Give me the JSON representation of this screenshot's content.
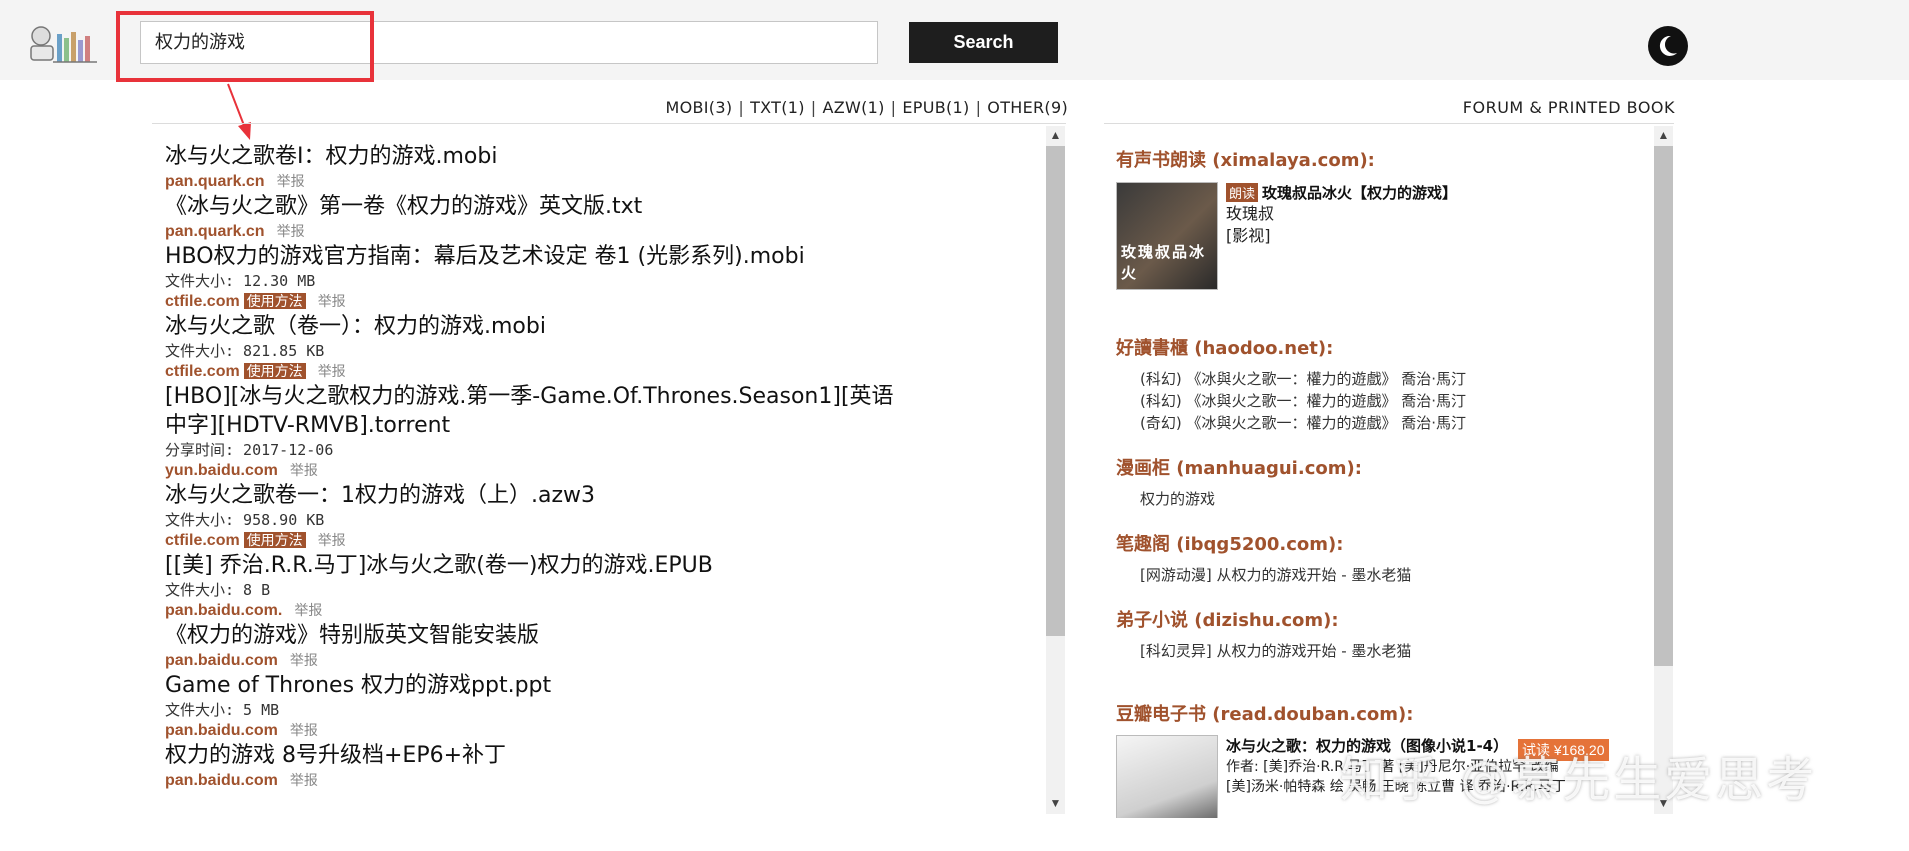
{
  "header": {
    "search": {
      "value": "权力的游戏"
    },
    "search_button_label": "Search"
  },
  "filters": {
    "items": [
      "MOBI(3)",
      "TXT(1)",
      "AZW(1)",
      "EPUB(1)",
      "OTHER(9)"
    ]
  },
  "forum_link": "FORUM & PRINTED BOOK",
  "results": [
    {
      "title": "冰与火之歌卷Ⅰ：权力的游戏.mobi",
      "meta": "",
      "source": "pan.quark.cn",
      "tag": "",
      "report": "举报"
    },
    {
      "title": "《冰与火之歌》第一卷《权力的游戏》英文版.txt",
      "meta": "",
      "source": "pan.quark.cn",
      "tag": "",
      "report": "举报"
    },
    {
      "title": "HBO权力的游戏官方指南：幕后及艺术设定 卷1 (光影系列).mobi",
      "meta": "文件大小: 12.30 MB",
      "source": "ctfile.com",
      "tag": "使用方法",
      "report": "举报"
    },
    {
      "title": "冰与火之歌（卷一）：权力的游戏.mobi",
      "meta": "文件大小: 821.85 KB",
      "source": "ctfile.com",
      "tag": "使用方法",
      "report": "举报"
    },
    {
      "title": "[HBO][冰与火之歌权力的游戏.第一季-Game.Of.Thrones.Season1][英语中字][HDTV-RMVB].torrent",
      "meta": "分享时间: 2017-12-06",
      "source": "yun.baidu.com",
      "tag": "",
      "report": "举报"
    },
    {
      "title": "冰与火之歌卷一：1权力的游戏（上）.azw3",
      "meta": "文件大小: 958.90 KB",
      "source": "ctfile.com",
      "tag": "使用方法",
      "report": "举报"
    },
    {
      "title": "[[美] 乔治.R.R.马丁]冰与火之歌(卷一)权力的游戏.EPUB",
      "meta": "文件大小: 8 B",
      "source": "pan.baidu.com.",
      "tag": "",
      "report": "举报"
    },
    {
      "title": "《权力的游戏》特别版英文智能安装版",
      "meta": "",
      "source": "pan.baidu.com",
      "tag": "",
      "report": "举报"
    },
    {
      "title": "Game of Thrones 权力的游戏ppt.ppt",
      "meta": "文件大小: 5 MB",
      "source": "pan.baidu.com",
      "tag": "",
      "report": "举报"
    },
    {
      "title": "权力的游戏 8号升级档+EP6+补丁",
      "meta": "",
      "source": "pan.baidu.com",
      "tag": "",
      "report": "举报"
    }
  ],
  "side": {
    "ximalaya": {
      "title": "有声书朗读 (ximalaya.com):",
      "badge": "朗读",
      "book_title": "玫瑰叔品冰火【权力的游戏】",
      "author": "玫瑰叔",
      "category": "[影视]",
      "cover_text": "玫瑰叔品冰火"
    },
    "haodoo": {
      "title": "好讀書櫃 (haodoo.net):",
      "items": [
        "(科幻) 《冰與火之歌一：權力的遊戲》 喬治·馬汀",
        "(科幻) 《冰與火之歌一：權力的遊戲》 喬治·馬汀",
        "(奇幻) 《冰與火之歌一：權力的遊戲》 喬治·馬汀"
      ]
    },
    "manhuagui": {
      "title": "漫画柜 (manhuagui.com):",
      "items": [
        "权力的游戏"
      ]
    },
    "ibqg": {
      "title": "笔趣阁 (ibqg5200.com):",
      "items": [
        "[网游动漫] 从权力的游戏开始 - 墨水老猫"
      ]
    },
    "dizishu": {
      "title": "弟子小说 (dizishu.com):",
      "items": [
        "[科幻灵异] 从权力的游戏开始 - 墨水老猫"
      ]
    },
    "douban": {
      "title": "豆瓣电子书 (read.douban.com):",
      "book_title": "冰与火之歌：权力的游戏（图像小说1-4）",
      "price_badge": "试读 ¥168.20",
      "author_line": "作者: [美]乔治·R.R.马丁 著 [美]丹尼尔·亚伯拉罕 改编",
      "extra_line": "[美]汤米·帕特森 绘 吴畅 王晓 陈立曹 译 乔治·R.R.马丁"
    }
  },
  "watermark": "知乎 @慕先生爱思考",
  "colors": {
    "accent": "#a0522d",
    "highlight": "#e8323a",
    "button": "#1e1e1e"
  }
}
